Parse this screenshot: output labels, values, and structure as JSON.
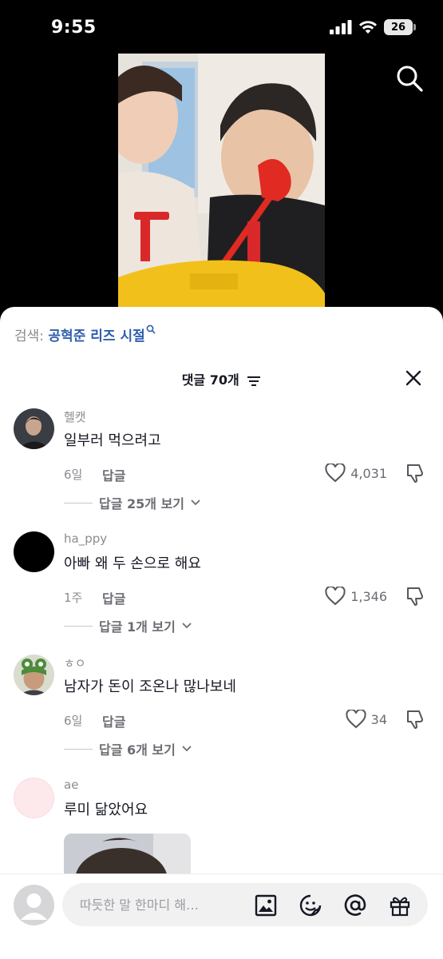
{
  "status": {
    "time": "9:55",
    "battery": "26"
  },
  "search": {
    "prefix": "검색: ",
    "query": "공혁준 리즈 시절"
  },
  "header": {
    "title": "댓글 70개"
  },
  "comments": [
    {
      "user": "헬캣",
      "text": "일부러 먹으려고",
      "age": "6일",
      "reply": "답글",
      "likes": "4,031",
      "more": "답글 25개 보기"
    },
    {
      "user": "ha_ppy",
      "text": "아빠 왜 두 손으로 해요",
      "age": "1주",
      "reply": "답글",
      "likes": "1,346",
      "more": "답글 1개 보기"
    },
    {
      "user": "ㅎㅇ",
      "text": "남자가 돈이 조온나 많나보네",
      "age": "6일",
      "reply": "답글",
      "likes": "34",
      "more": "답글 6개 보기"
    },
    {
      "user": "ae",
      "text": "루미 닮았어요"
    }
  ],
  "composer": {
    "placeholder": "따듯한 말 한마디 해…"
  },
  "icons": [
    "search-icon",
    "sort-icon",
    "close-icon",
    "heart-icon",
    "dislike-icon",
    "chevron-down-icon",
    "image-icon",
    "sticker-icon",
    "mention-icon",
    "gift-icon"
  ]
}
